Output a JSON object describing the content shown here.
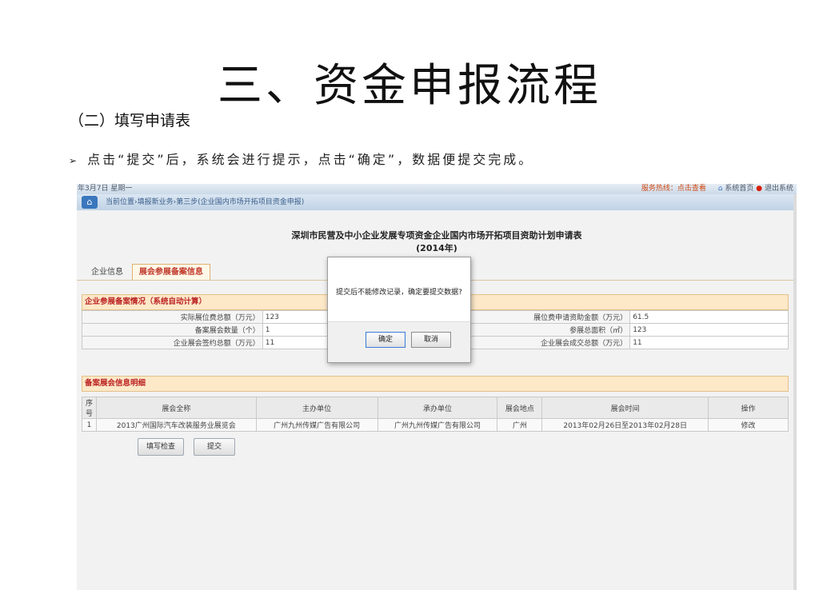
{
  "slide": {
    "title": "三、资金申报流程",
    "section": "（二）填写申请表",
    "bullet_mark": "➢",
    "bullet": "点击“提交”后，系统会进行提示，点击“确定”，数据便提交完成。"
  },
  "app": {
    "topbar": {
      "date": "年3月7日 星期一",
      "hotline": "服务热线：点击查看",
      "home_link": "系统首页",
      "exit_link": "退出系统"
    },
    "breadcrumb": "当前位置›填报新业务›第三步(企业国内市场开拓项目资金申报)",
    "form_title": "深圳市民营及中小企业发展专项资金企业国内市场开拓项目资助计划申请表",
    "form_year": "(2014年)",
    "tabs": [
      "企业信息",
      "展会参展备案信息"
    ],
    "summary": {
      "heading": "企业参展备案情况（系统自动计算）",
      "rows": [
        {
          "l1": "实际展位费总额（万元）",
          "v1": "123",
          "l2": "展位费申请资助金额（万元）",
          "v2": "61.5"
        },
        {
          "l1": "备案展会数量（个）",
          "v1": "1",
          "l2": "参展总面积（㎡）",
          "v2": "123"
        },
        {
          "l1": "企业展会签约总额（万元）",
          "v1": "11",
          "l2": "企业展会成交总额（万元）",
          "v2": "11"
        }
      ]
    },
    "detail": {
      "heading": "备案展会信息明细",
      "columns": [
        "序号",
        "展会全称",
        "主办单位",
        "承办单位",
        "展会地点",
        "展会时间",
        "操作"
      ],
      "rows": [
        [
          "1",
          "2013广州国际汽车改装服务业展览会",
          "广州九州传媒广告有限公司",
          "广州九州传媒广告有限公司",
          "广州",
          "2013年02月26日至2013年02月28日",
          "修改"
        ]
      ]
    },
    "buttons": {
      "check": "填写检查",
      "submit": "提交"
    },
    "dialog": {
      "message": "提交后不能修改记录，确定要提交数据?",
      "ok": "确定",
      "cancel": "取消"
    }
  }
}
